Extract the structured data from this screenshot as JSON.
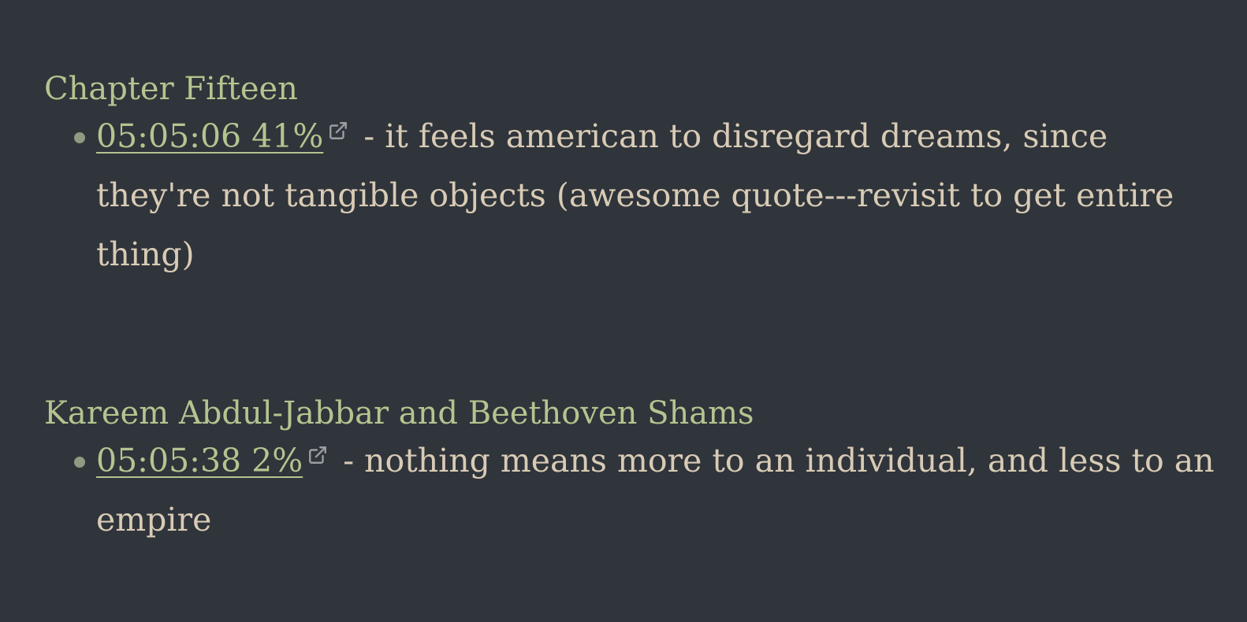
{
  "colors": {
    "background": "#30343b",
    "heading": "#b2c58f",
    "link": "#b2c58f",
    "text": "#d8cbb5",
    "bullet": "#8f9a83",
    "icon": "#9a9ea3"
  },
  "sections": [
    {
      "heading": "Chapter Fifteen",
      "highlights": [
        {
          "timestamp": "05:05:06 41%",
          "icon": "external-link-icon",
          "note": " - it feels american to disregard dreams, since they're not tangible objects (awesome quote---revisit to get entire thing)"
        }
      ]
    },
    {
      "heading": "Kareem Abdul-Jabbar and Beethoven Shams",
      "highlights": [
        {
          "timestamp": "05:05:38 2%",
          "icon": "external-link-icon",
          "note": " - nothing means more to an individual, and less to an empire"
        }
      ]
    }
  ]
}
